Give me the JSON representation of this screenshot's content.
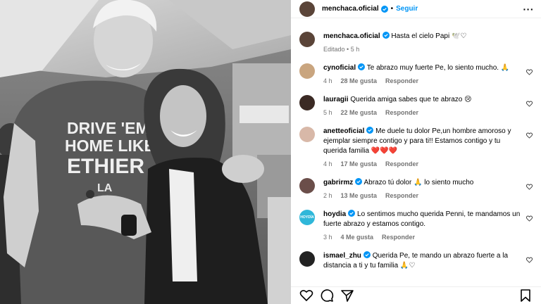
{
  "header": {
    "username": "menchaca.oficial",
    "separator": "•",
    "follow_label": "Seguir",
    "more_label": "···"
  },
  "caption": {
    "username": "menchaca.oficial",
    "text": "Hasta el cielo Papi 🕊️♡",
    "edited": "Editado",
    "time": "5 h"
  },
  "comments": [
    {
      "username": "cynoficial",
      "text": "Te abrazo muy fuerte Pe, lo siento mucho. 🙏",
      "time": "4 h",
      "likes": "28 Me gusta",
      "reply": "Responder",
      "avatar_color": "#c9a57f"
    },
    {
      "username": "lauragii",
      "text": "Querida amiga sabes que te abrazo 😢",
      "time": "5 h",
      "likes": "22 Me gusta",
      "reply": "Responder",
      "avatar_color": "#3b2a24"
    },
    {
      "username": "anetteoficial",
      "text": "Me duele tu dolor Pe,un hombre amoroso y ejemplar siempre contigo y para ti!! Estamos contigo y tu querida familia ❤️❤️❤️",
      "time": "4 h",
      "likes": "17 Me gusta",
      "reply": "Responder",
      "avatar_color": "#d8b8a8"
    },
    {
      "username": "gabrirmz",
      "text": "Abrazo tú dolor 🙏 lo siento mucho",
      "time": "2 h",
      "likes": "13 Me gusta",
      "reply": "Responder",
      "avatar_color": "#6b4e4a"
    },
    {
      "username": "hoydia",
      "text": "Lo sentimos mucho querida Penni, te mandamos un fuerte abrazo y estamos contigo.",
      "time": "3 h",
      "likes": "4 Me gusta",
      "reply": "Responder",
      "avatar_color": "#2fb7d9",
      "avatar_text": "HOYDÍA"
    },
    {
      "username": "ismael_zhu",
      "text": "Querida Pe, te mando un abrazo fuerte a la distancia a ti y tu familia 🙏♡",
      "time": "",
      "likes": "",
      "reply": "",
      "avatar_color": "#222222"
    }
  ],
  "photo": {
    "shirt_text": [
      "DRIVE 'EM",
      "HOME LIKE",
      "ETHIER"
    ],
    "cap_text": "LA"
  },
  "colors": {
    "accent": "#0095f6",
    "verified": "#0095f6",
    "muted": "#737373"
  },
  "icons": [
    "heart-icon",
    "comment-icon",
    "share-icon",
    "bookmark-icon",
    "more-icon",
    "verified-icon"
  ]
}
